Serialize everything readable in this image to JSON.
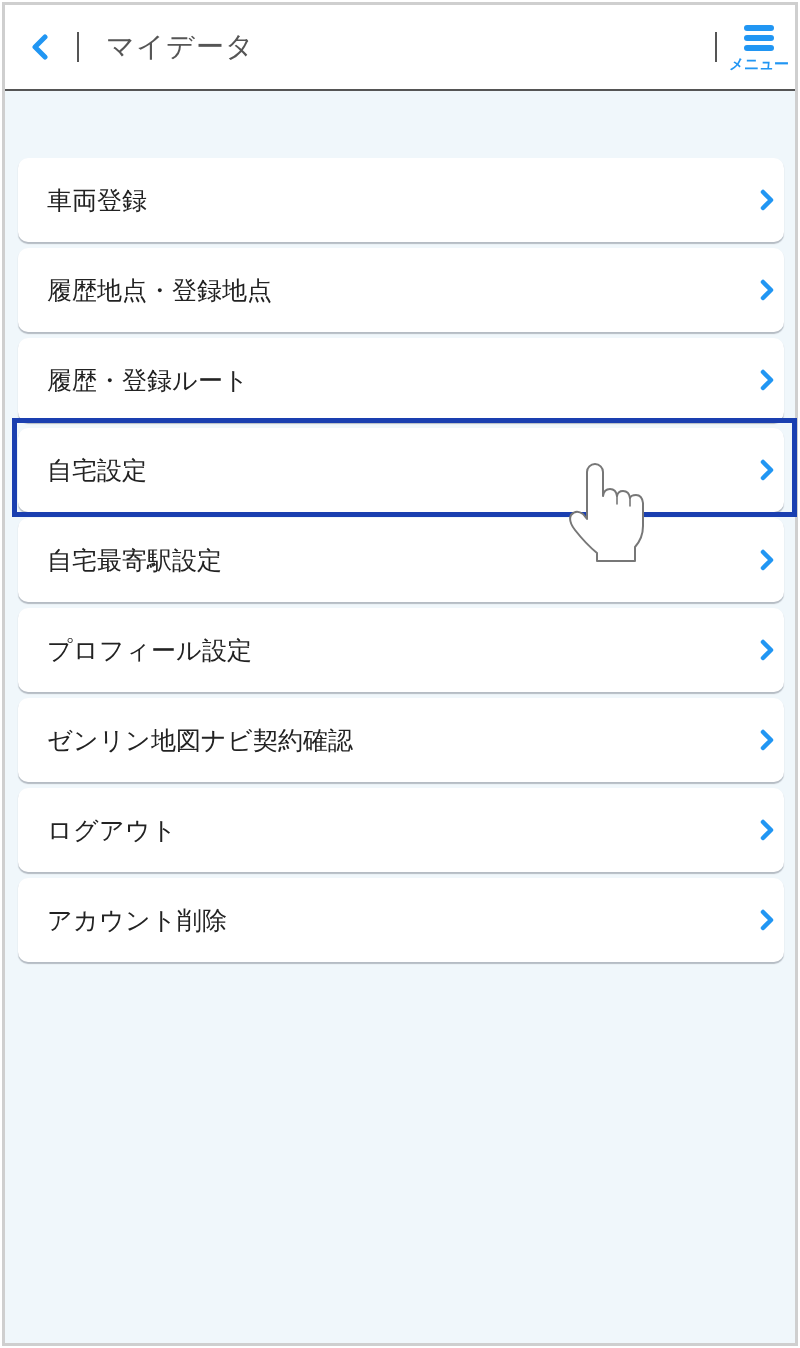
{
  "header": {
    "title": "マイデータ",
    "menu_label": "メニュー"
  },
  "menu_items": [
    {
      "label": "車両登録",
      "highlighted": false
    },
    {
      "label": "履歴地点・登録地点",
      "highlighted": false
    },
    {
      "label": "履歴・登録ルート",
      "highlighted": false
    },
    {
      "label": "自宅設定",
      "highlighted": true
    },
    {
      "label": "自宅最寄駅設定",
      "highlighted": false
    },
    {
      "label": "プロフィール設定",
      "highlighted": false
    },
    {
      "label": "ゼンリン地図ナビ契約確認",
      "highlighted": false
    },
    {
      "label": "ログアウト",
      "highlighted": false
    },
    {
      "label": "アカウント削除",
      "highlighted": false
    }
  ]
}
